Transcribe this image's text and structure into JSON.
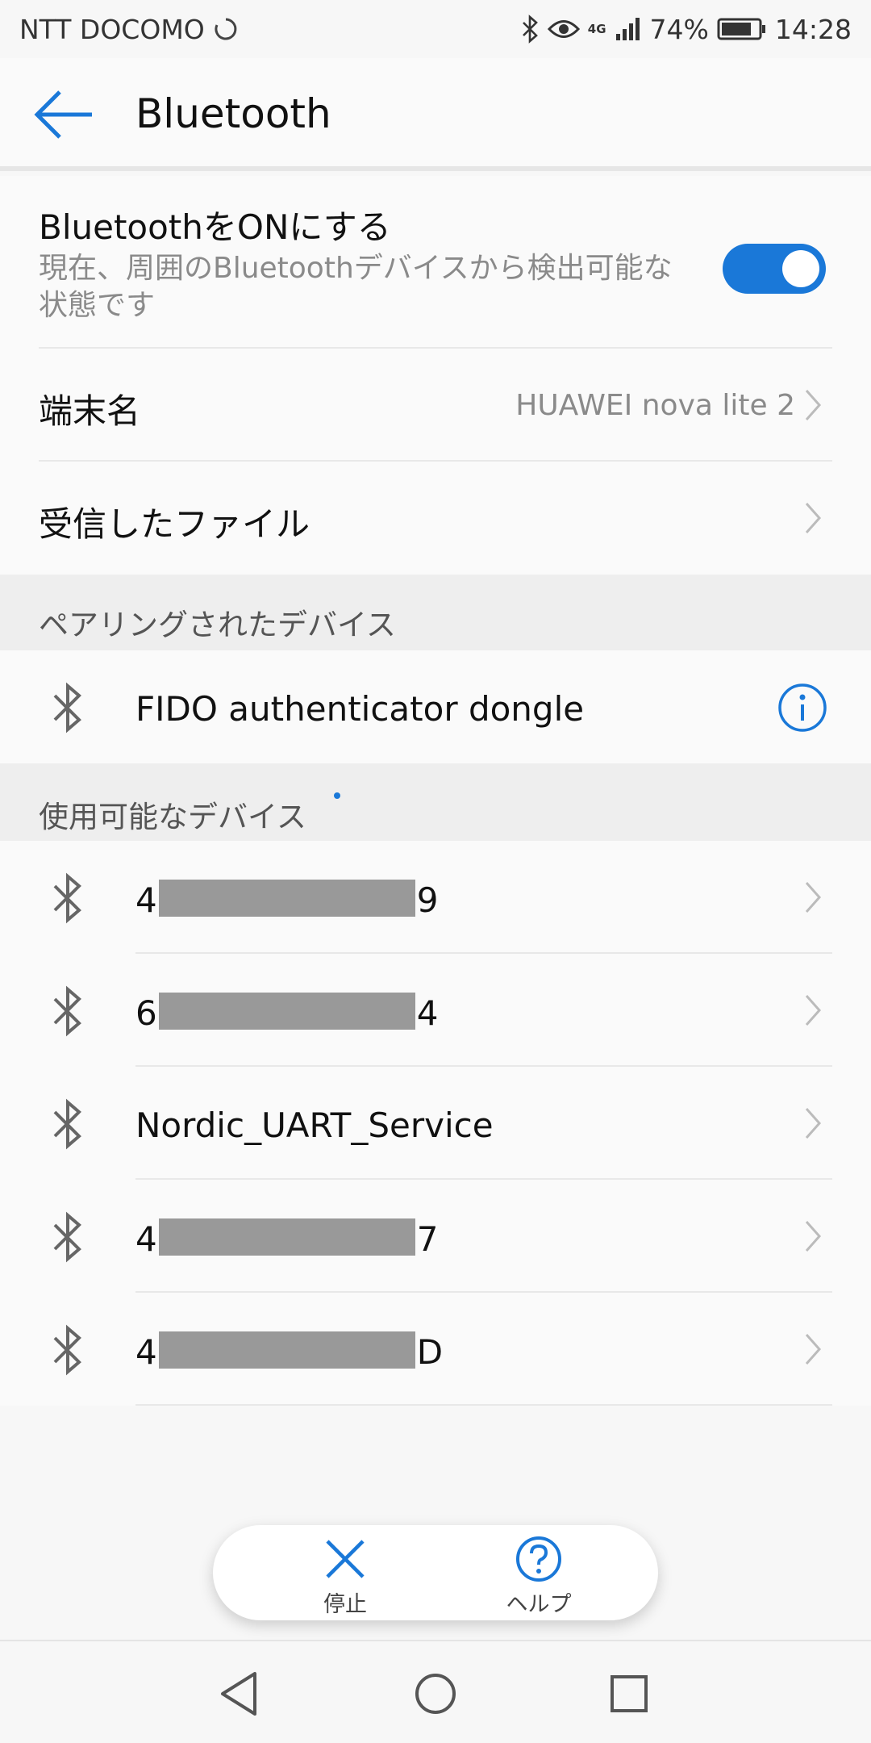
{
  "status_bar": {
    "carrier": "NTT DOCOMO",
    "network": "4G",
    "battery": "74%",
    "time": "14:28",
    "icons": [
      "sync-icon",
      "bluetooth-icon",
      "eye-icon",
      "signal-icon",
      "battery-icon"
    ]
  },
  "app_bar": {
    "title": "Bluetooth"
  },
  "bluetooth_toggle": {
    "title": "BluetoothをONにする",
    "subtitle": "現在、周囲のBluetoothデバイスから検出可能な状態です",
    "on": true
  },
  "device_name": {
    "label": "端末名",
    "value": "HUAWEI nova lite 2"
  },
  "received_files": {
    "label": "受信したファイル"
  },
  "paired_section": {
    "header": "ペアリングされたデバイス",
    "devices": [
      {
        "name": "FIDO authenticator dongle"
      }
    ]
  },
  "available_section": {
    "header": "使用可能なデバイス",
    "devices": [
      {
        "prefix": "4",
        "suffix": "9",
        "redacted": true
      },
      {
        "prefix": "6",
        "suffix": "4",
        "redacted": true
      },
      {
        "prefix": "Nordic_UART_Service",
        "suffix": "",
        "redacted": false
      },
      {
        "prefix": "4",
        "suffix": "7",
        "redacted": true
      },
      {
        "prefix": "4",
        "suffix": "D",
        "redacted": true
      }
    ]
  },
  "bottom_actions": {
    "stop_label": "停止",
    "help_label": "ヘルプ"
  },
  "colors": {
    "accent": "#1a78d8",
    "section_bg": "#eeeeee",
    "background": "#fafafa"
  }
}
